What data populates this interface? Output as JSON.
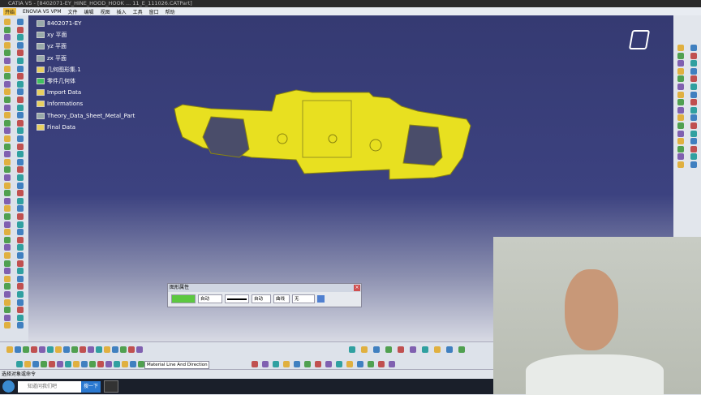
{
  "window": {
    "title": "CATIA V5 - [8402071-EY_HINE_HOOD_HOOK ... 11_E_111026.CATPart]"
  },
  "menu": {
    "items": [
      "开始",
      "ENOVIA V5 VPM",
      "文件",
      "编辑",
      "视图",
      "插入",
      "工具",
      "窗口",
      "帮助"
    ]
  },
  "tree": {
    "items": [
      "8402071-EY",
      "xy 平面",
      "yz 平面",
      "zx 平面",
      "几何图形集.1",
      "零件几何体",
      "Import Data",
      "Informations",
      "Theory_Data_Sheet_Metal_Part",
      "Final Data"
    ]
  },
  "graphic_panel": {
    "title": "图形属性",
    "fill_color": "#5cc840",
    "options": [
      "自动",
      "",
      "自动",
      "曲线",
      "曲线",
      "无"
    ]
  },
  "toolbar": {
    "material_select": "Material Line And Direction"
  },
  "status": {
    "text": "选择对象或命令"
  },
  "taskbar": {
    "search_placeholder": "知道问我们吧",
    "search_button": "搜一下"
  },
  "colors": {
    "part": "#e8e020",
    "viewport_top": "#353a72"
  }
}
